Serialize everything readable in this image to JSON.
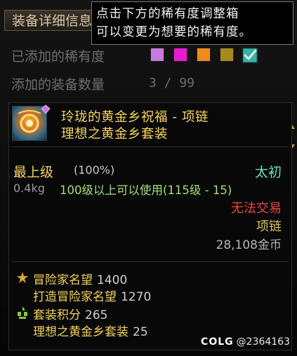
{
  "header": {
    "title": "装备详细信息"
  },
  "tooltip": {
    "line1": "点击下方的稀有度调整箱",
    "line2": "可以变更为想要的稀有度。"
  },
  "filters": {
    "rarity_label": "已添加的稀有度",
    "count_label": "添加的装备数量",
    "count_value": "3 / 99",
    "swatches": [
      {
        "name": "purple",
        "color": "#c77be0"
      },
      {
        "name": "magenta",
        "color": "#e81ad4"
      },
      {
        "name": "orange",
        "color": "#f08a1c"
      },
      {
        "name": "olive",
        "color": "#a58b1e"
      },
      {
        "name": "teal-checked",
        "color": "#34b4a8"
      }
    ]
  },
  "item": {
    "name": "玲珑的黄金乡祝福 - 项链",
    "set_name": "理想之黄金乡套装",
    "grade": "最上级",
    "grade_pct": "(100%)",
    "rarity": "太初",
    "weight": "0.4kg",
    "level_req": "100级以上可以使用(115级 - 15)",
    "trade": "无法交易",
    "slot": "项链",
    "price": "28,108金币",
    "stats": [
      {
        "label": "冒险家名望",
        "value": "1400"
      },
      {
        "label": "打造冒险家名望",
        "value": "1270"
      },
      {
        "label": "套装积分",
        "value": "265"
      },
      {
        "label": "理想之黄金乡套装",
        "value": "25"
      }
    ]
  },
  "watermark": {
    "logo": "COLG",
    "handle": "@2364163"
  }
}
